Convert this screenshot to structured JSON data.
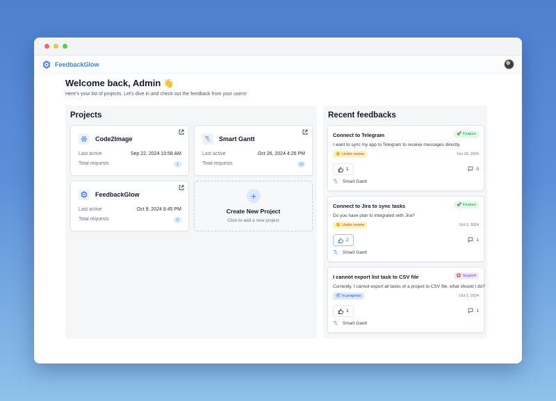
{
  "app": {
    "brand": "FeedbackGlow"
  },
  "colors": {
    "accent": "#3b82f6",
    "feature": "#16a34a",
    "support": "#7c3aed",
    "review": "#b45309"
  },
  "header": {
    "welcome": "Welcome back, Admin",
    "wave_emoji": "👋",
    "subtitle": "Here's your list of projects. Let's dive in and check out the feedback from your users!"
  },
  "projects": {
    "title": "Projects",
    "labels": {
      "last_active": "Last active",
      "total_requests": "Total requests"
    },
    "items": [
      {
        "name": "Code2Image",
        "icon": "code2image-icon",
        "last_active": "Sep 22, 2024 10:58 AM",
        "total_requests": "1"
      },
      {
        "name": "Smart Gantt",
        "icon": "gantt-icon",
        "last_active": "Oct 26, 2024 4:26 PM",
        "total_requests": "13"
      },
      {
        "name": "FeedbackGlow",
        "icon": "feedbackglow-icon",
        "last_active": "Oct 9, 2024 8:45 PM",
        "total_requests": "0"
      }
    ],
    "new_project": {
      "title": "Create New Project",
      "subtitle": "Click to add a new project"
    }
  },
  "feedbacks": {
    "title": "Recent feedbacks",
    "items": [
      {
        "title": "Connect to Telegram",
        "tag": "Feature",
        "description": "I want to sync my app to Telegram to receive messages directly.",
        "status": "Under review",
        "date": "Oct 18, 2024",
        "votes": "1",
        "comments": "0",
        "project": "Smart Gantt"
      },
      {
        "title": "Connect to Jira to sync tasks",
        "tag": "Feature",
        "description": "Do you have plan to integrated with Jira?",
        "status": "Under review",
        "date": "Oct 3, 2024",
        "votes": "2",
        "comments": "1",
        "project": "Smart Gantt"
      },
      {
        "title": "I cannot export list task to CSV file",
        "tag": "Support",
        "description": "Currently, I cannot export all tasks of a project to CSV file, what should I do?",
        "status": "In progress",
        "date": "Oct 2, 2024",
        "votes": "1",
        "comments": "1",
        "project": "Smart Gantt"
      }
    ]
  }
}
